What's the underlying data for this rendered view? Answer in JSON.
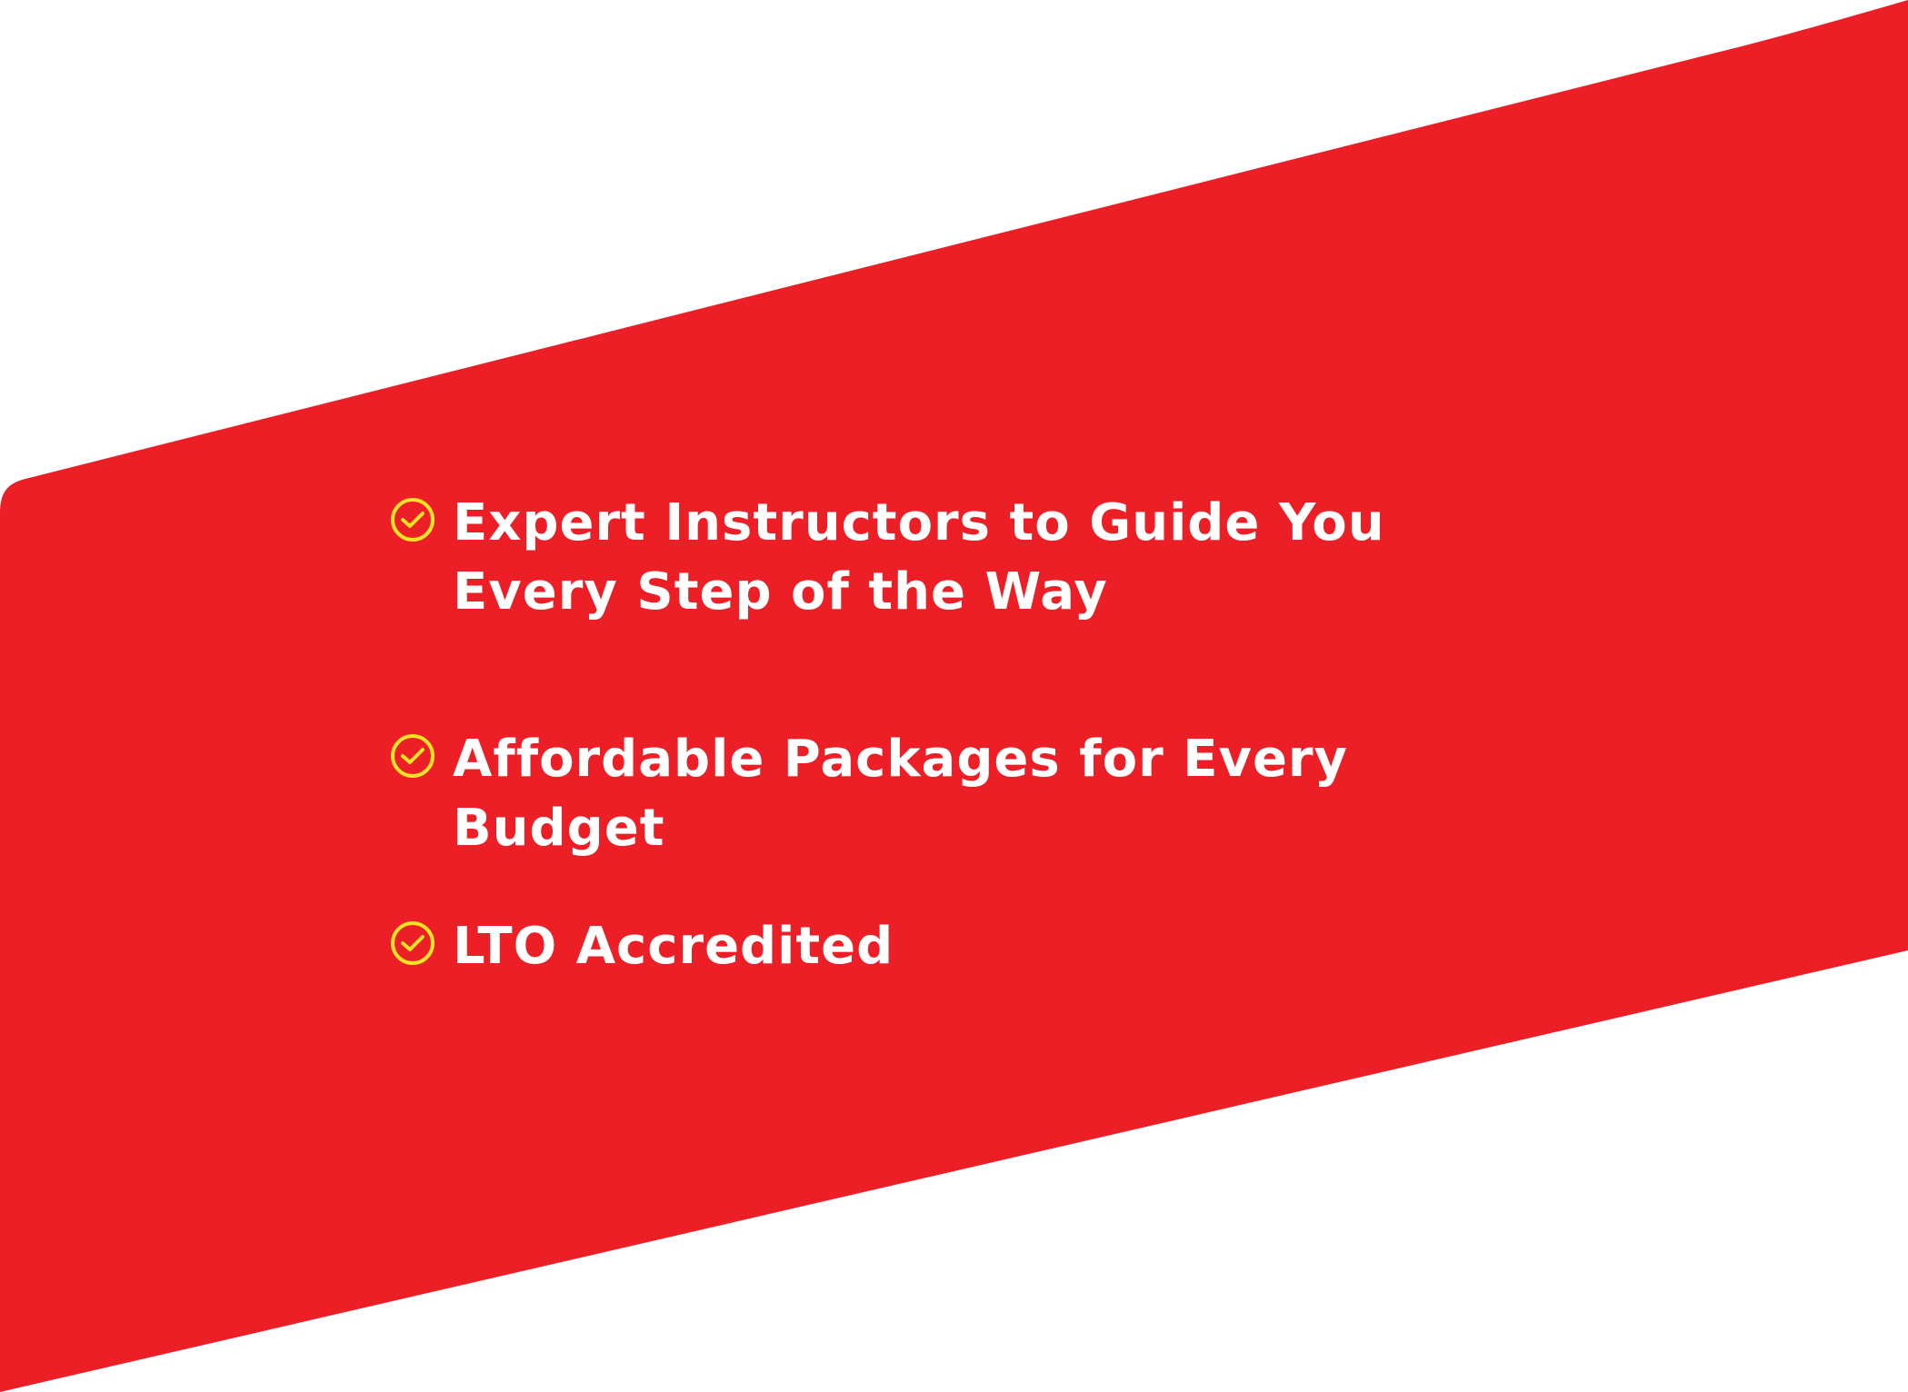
{
  "colors": {
    "banner_red": "#ed1f26",
    "check_yellow": "#f2e326",
    "text": "#ffffff",
    "background": "#ffffff"
  },
  "features": {
    "icon": "check-circle-icon",
    "items": [
      {
        "label": "Expert Instructors to Guide You Every Step of the Way"
      },
      {
        "label": "Affordable Packages for Every Budget"
      },
      {
        "label": "LTO Accredited"
      }
    ]
  }
}
